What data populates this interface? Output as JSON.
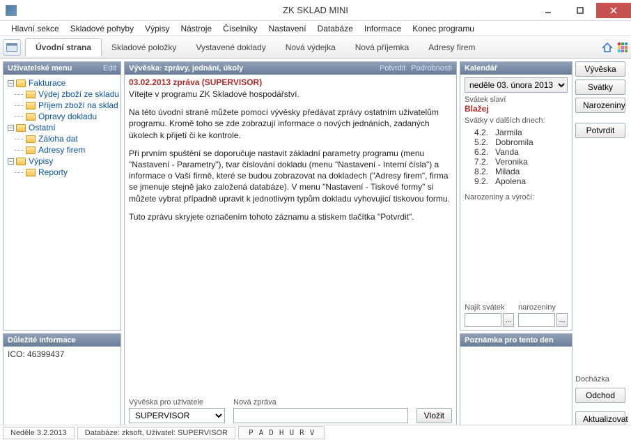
{
  "window": {
    "title": "ZK SKLAD MINI"
  },
  "menubar": {
    "items": [
      "Hlavní sekce",
      "Skladové pohyby",
      "Výpisy",
      "Nástroje",
      "Číselníky",
      "Nastavení",
      "Databáze",
      "Informace",
      "Konec programu"
    ]
  },
  "tabs": {
    "active": "Úvodní strana",
    "items": [
      "Úvodní strana",
      "Skladové položky",
      "Vystavené doklady",
      "Nová výdejka",
      "Nová příjemka",
      "Adresy firem"
    ]
  },
  "user_menu": {
    "title": "Uživatelské menu",
    "edit_link": "Edit",
    "nodes": [
      {
        "label": "Fakturace",
        "children": [
          "Výdej zboží ze skladu",
          "Příjem zboží na sklad",
          "Opravy dokladu"
        ]
      },
      {
        "label": "Ostatní",
        "children": [
          "Záloha dat",
          "Adresy firem"
        ]
      },
      {
        "label": "Výpisy",
        "children": [
          "Reporty"
        ]
      }
    ]
  },
  "notice": {
    "header": "Vývěska: zprávy, jednání, úkoly",
    "confirm_link": "Potvrdit",
    "details_link": "Podrobnosti",
    "title": "03.02.2013 zpráva (SUPERVISOR)",
    "p1": "Vítejte v programu ZK Skladové hospodářství.",
    "p2": "Na této úvodní straně můžete pomocí vývěsky předávat zprávy ostatním uživatelům programu. Kromě toho se zde zobrazují informace o nových jednáních, zadaných úkolech k přijetí či ke kontrole.",
    "p3": "Při prvním spuštění se doporučuje nastavit základní parametry programu (menu \"Nastavení - Parametry\"), tvar číslování dokladu  (menu \"Nastavení - Interní čísla\") a informace o Vaší firmě, které se budou zobrazovat na dokladech (\"Adresy firem\", firma se jmenuje stejně jako založená databáze). V menu \"Nastavení - Tiskové formy\" si můžete vybrat případně upravit k jednotlivým typům dokladu vyhovující tiskovou formu.",
    "p4": "Tuto zprávu skryjete označením tohoto záznamu a stiskem tlačítka \"Potvrdit\".",
    "user_label": "Vývěska pro uživatele",
    "user_value": "SUPERVISOR",
    "new_msg_label": "Nová zpráva",
    "insert_btn": "Vložit"
  },
  "calendar": {
    "header": "Kalendář",
    "date_select": "neděle  03.  února   2013",
    "celebrates_label": "Svátek slaví",
    "celebrates_name": "Blažej",
    "upcoming_label": "Svátky v dalších dnech:",
    "days": [
      {
        "d": "4.2.",
        "n": "Jarmila"
      },
      {
        "d": "5.2.",
        "n": "Dobromila"
      },
      {
        "d": "6.2.",
        "n": "Vanda"
      },
      {
        "d": "7.2.",
        "n": "Veronika"
      },
      {
        "d": "8.2.",
        "n": "Milada"
      },
      {
        "d": "9.2.",
        "n": "Apolena"
      }
    ],
    "birthdays_label": "Narozeniny a výročí:",
    "find_label": "Najít svátek",
    "bday_label": "narozeniny"
  },
  "info_panel": {
    "header": "Důležité informace",
    "text": "ICO: 46399437"
  },
  "note_panel": {
    "header": "Poznámka pro tento den"
  },
  "side_buttons": {
    "top": [
      "Vývěska",
      "Svátky",
      "Narozeniny",
      "Potvrdit"
    ],
    "bottom_label": "Docházka",
    "bottom": [
      "Odchod",
      "Aktualizovat"
    ]
  },
  "statusbar": {
    "date": "Neděle 3.2.2013",
    "db": "Databáze: zksoft, Uživatel: SUPERVISOR",
    "flags": [
      "P",
      "A",
      "D",
      "H",
      "U",
      "R",
      "V"
    ]
  }
}
